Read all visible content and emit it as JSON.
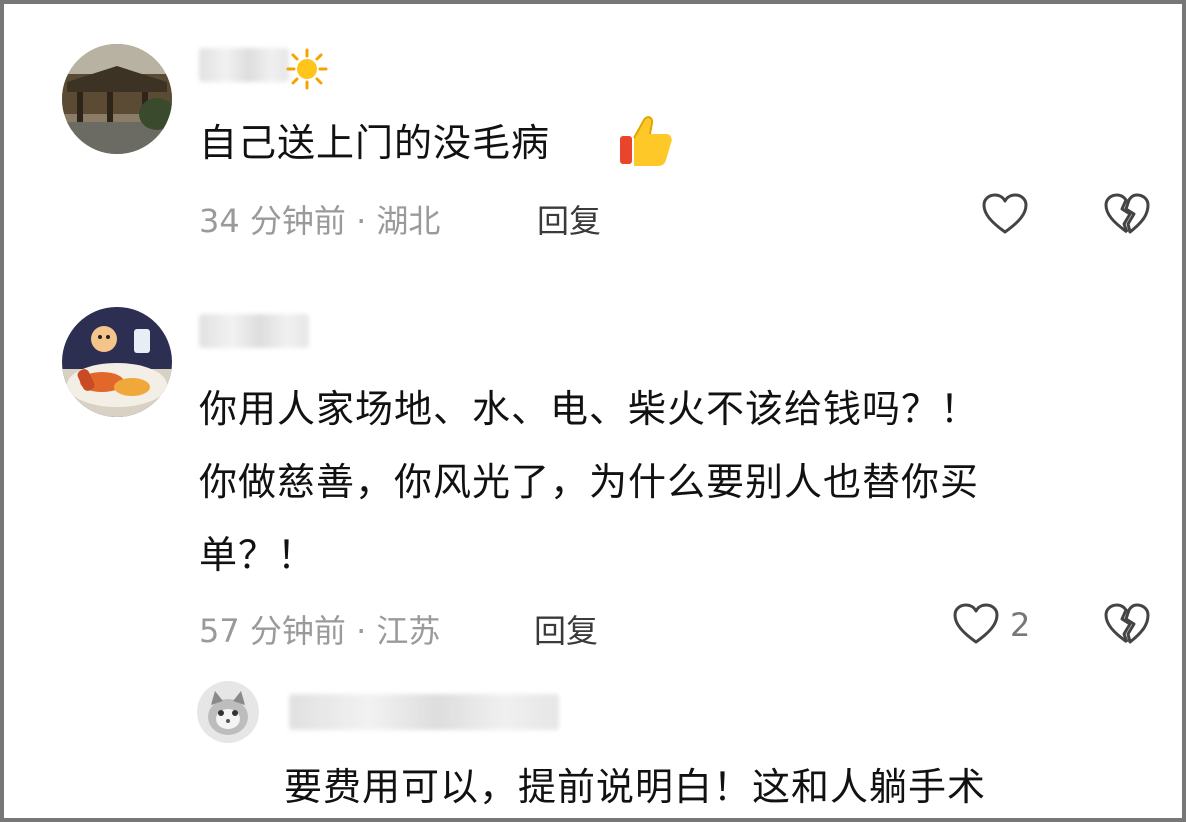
{
  "comments": [
    {
      "text": "自己送上门的没毛病",
      "time": "34 分钟前",
      "location": "湖北",
      "reply_label": "回复"
    },
    {
      "lines": [
        "你用人家场地、水、电、柴火不该给钱吗？！",
        "你做慈善，你风光了，为什么要别人也替你买",
        "单？！"
      ],
      "time": "57 分钟前",
      "location": "江苏",
      "reply_label": "回复",
      "like_count": "2"
    },
    {
      "text": "要费用可以，提前说明白！这和人躺手术"
    }
  ],
  "meta_separator": " · ",
  "icons": {
    "like": "heart-outline-icon",
    "dislike": "broken-heart-icon",
    "emoji_sun": "sun-emoji",
    "emoji_thumb": "thumbs-up-emoji"
  },
  "colors": {
    "text": "#111111",
    "meta": "#9a9a9a",
    "icon": "#444444"
  }
}
